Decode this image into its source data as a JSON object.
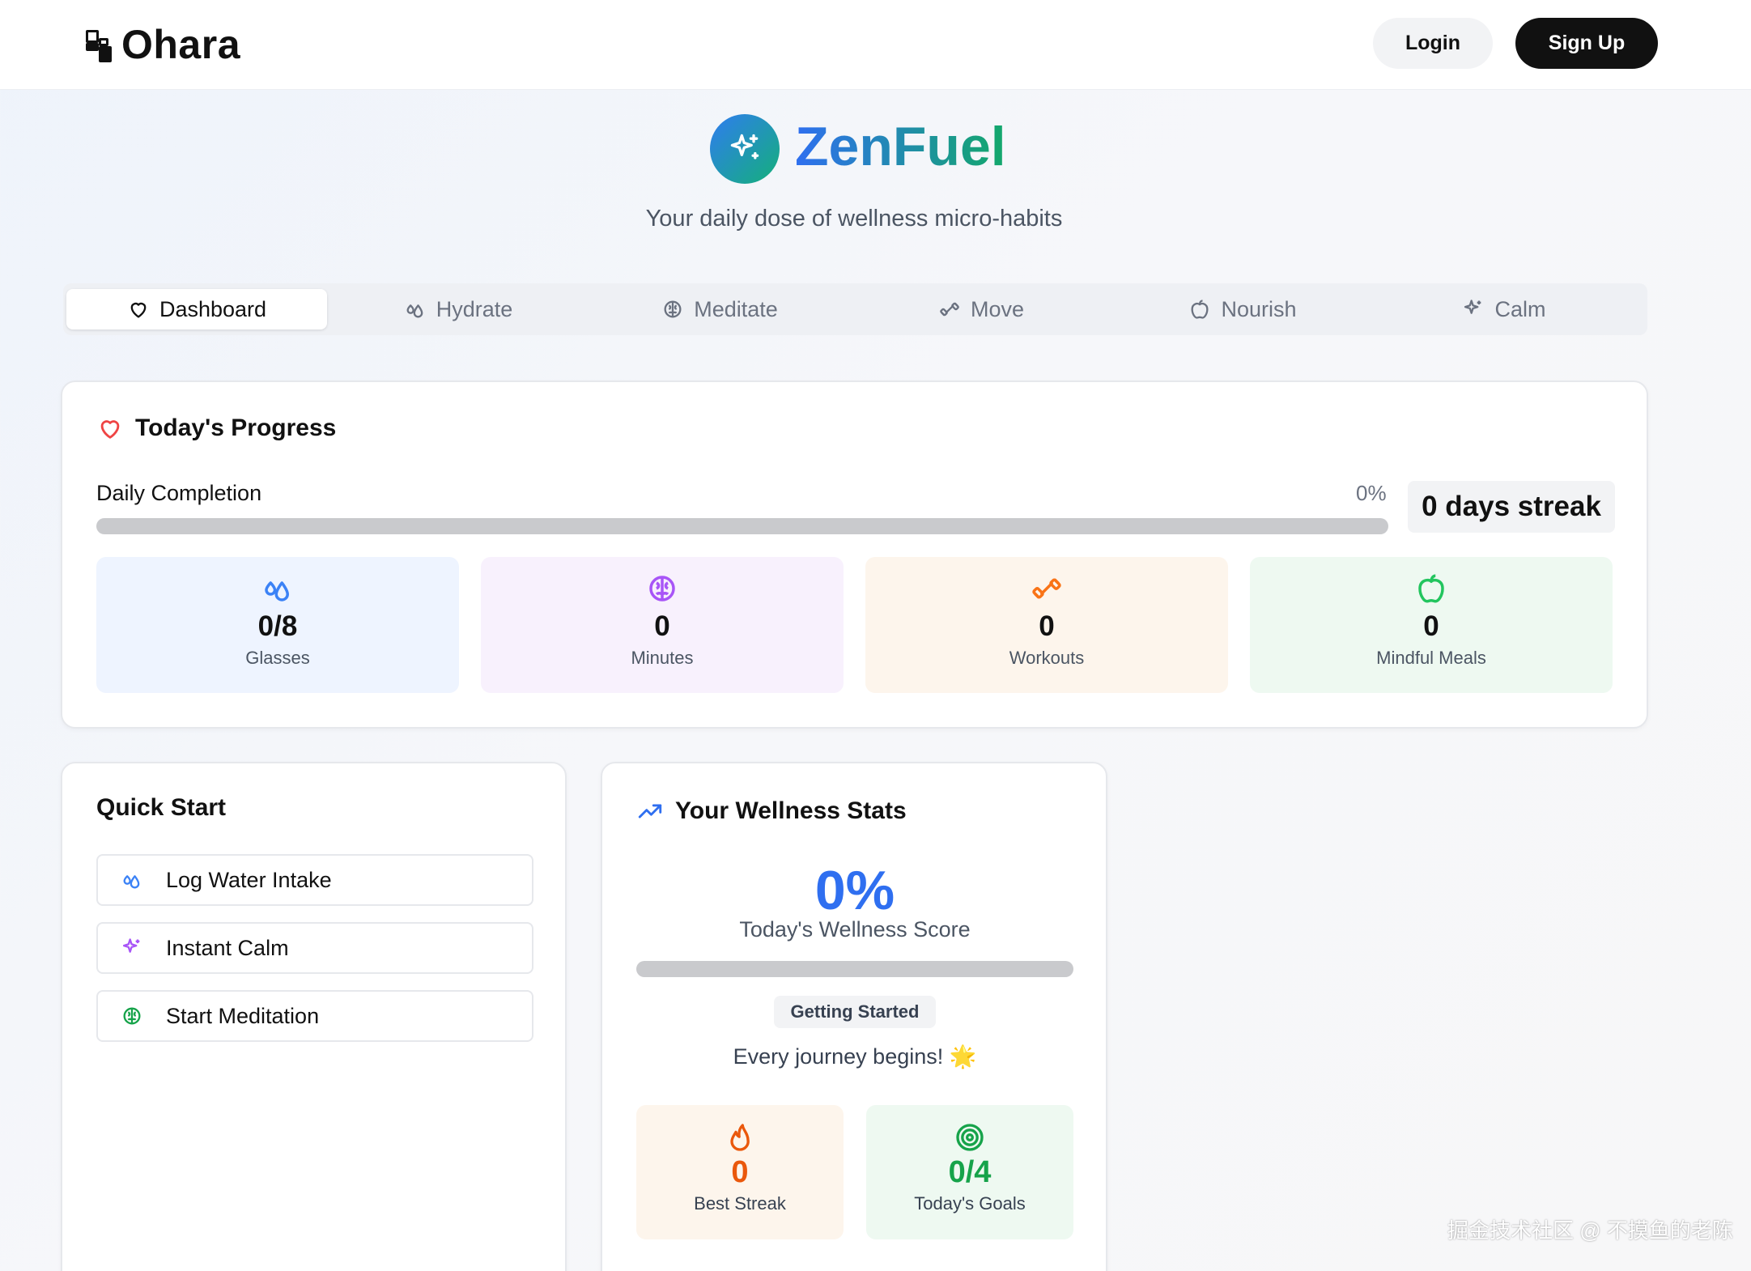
{
  "header": {
    "brand": "Ohara",
    "login": "Login",
    "signup": "Sign Up"
  },
  "hero": {
    "title": "ZenFuel",
    "subtitle": "Your daily dose of wellness micro-habits"
  },
  "tabs": [
    {
      "label": "Dashboard",
      "icon": "heart-icon",
      "active": true
    },
    {
      "label": "Hydrate",
      "icon": "droplets-icon",
      "active": false
    },
    {
      "label": "Meditate",
      "icon": "brain-icon",
      "active": false
    },
    {
      "label": "Move",
      "icon": "dumbbell-icon",
      "active": false
    },
    {
      "label": "Nourish",
      "icon": "apple-icon",
      "active": false
    },
    {
      "label": "Calm",
      "icon": "sparkles-icon",
      "active": false
    }
  ],
  "progress": {
    "title": "Today's Progress",
    "label": "Daily Completion",
    "percent_text": "0%",
    "percent": 0,
    "streak": "0 days streak",
    "stats": [
      {
        "value": "0/8",
        "label": "Glasses",
        "icon": "droplets-icon",
        "color": "#3b82f6"
      },
      {
        "value": "0",
        "label": "Minutes",
        "icon": "brain-icon",
        "color": "#a855f7"
      },
      {
        "value": "0",
        "label": "Workouts",
        "icon": "dumbbell-icon",
        "color": "#f97316"
      },
      {
        "value": "0",
        "label": "Mindful Meals",
        "icon": "apple-icon",
        "color": "#22c55e"
      }
    ]
  },
  "quick_start": {
    "title": "Quick Start",
    "items": [
      {
        "label": "Log Water Intake",
        "icon": "droplets-icon"
      },
      {
        "label": "Instant Calm",
        "icon": "sparkles-icon"
      },
      {
        "label": "Start Meditation",
        "icon": "brain-icon"
      }
    ]
  },
  "wellness": {
    "title": "Your Wellness Stats",
    "score": "0%",
    "score_value": 0,
    "score_label": "Today's Wellness Score",
    "level": "Getting Started",
    "message": "Every journey begins! 🌟",
    "tiles": [
      {
        "value": "0",
        "label": "Best Streak",
        "icon": "flame-icon",
        "color": "#ea580c"
      },
      {
        "value": "0/4",
        "label": "Today's Goals",
        "icon": "target-icon",
        "color": "#16a34a"
      }
    ]
  },
  "watermark": "掘金技术社区 @ 不摸鱼的老陈",
  "colors": {
    "accent_blue": "#2f6ff0",
    "accent_green": "#13a86a",
    "dark": "#111111"
  }
}
